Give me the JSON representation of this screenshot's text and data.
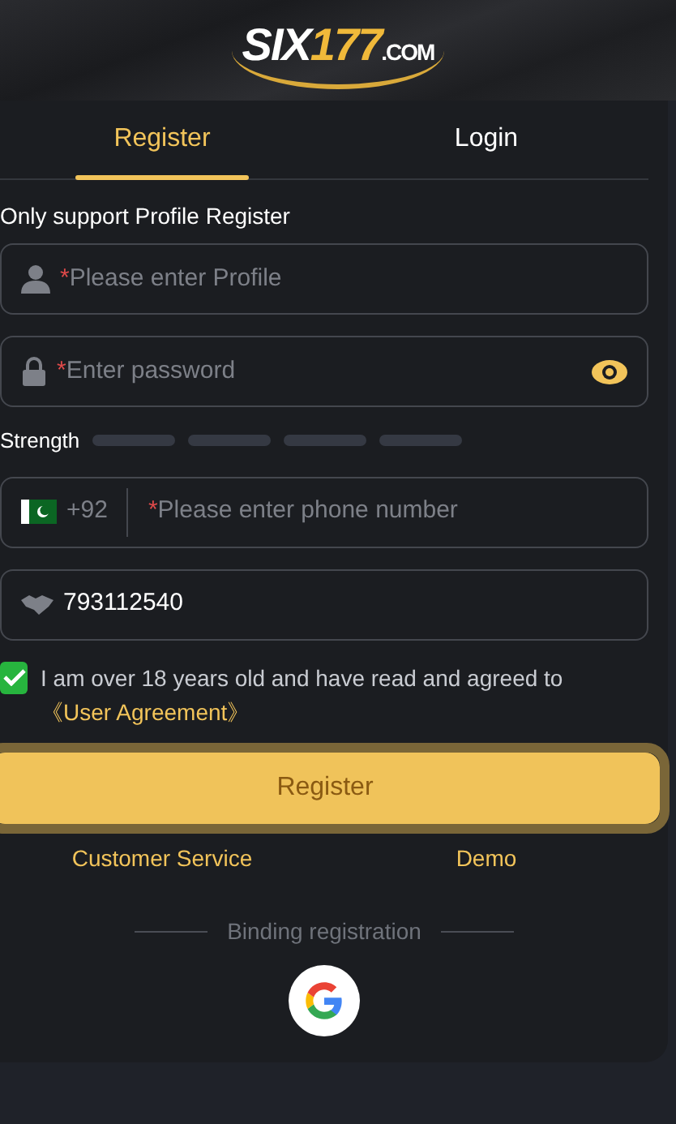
{
  "logo": {
    "part1": "SIX",
    "part2": "177",
    "part3": ".COM"
  },
  "tabs": [
    {
      "label": "Register",
      "selected": true
    },
    {
      "label": "Login",
      "selected": false
    }
  ],
  "notice": "Only support Profile Register",
  "profile_field": {
    "required_mark": "*",
    "placeholder": "Please enter Profile"
  },
  "password_field": {
    "required_mark": "*",
    "placeholder": "Enter password"
  },
  "strength": {
    "label": "Strength"
  },
  "phone_field": {
    "country_code": "+92",
    "required_mark": "*",
    "placeholder": "Please enter phone number"
  },
  "referral_field": {
    "value": "793112540"
  },
  "agreement": {
    "checked": true,
    "text": "I am over 18 years old and have read and agreed to ",
    "link": "《User Agreement》"
  },
  "register_button": "Register",
  "links": [
    "Customer Service",
    "Demo"
  ],
  "divider_label": "Binding registration",
  "social": [
    {
      "kind": "google"
    }
  ]
}
